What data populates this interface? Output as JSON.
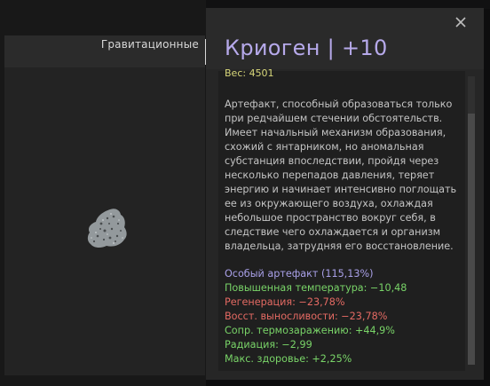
{
  "category_label": "Гравитационные",
  "window": {
    "title": "Криоген | +10"
  },
  "weight_text": "Вес: 4501",
  "description": "Артефакт, способный образоваться только при редчайшем стечении обстоятельств. Имеет начальный механизм образования, схожий с янтарником, но аномальная субстанция впоследствии, пройдя через несколько перепадов давления, теряет энергию и начинает интенсивно поглощать ее из окружающего воздуха, охлаждая небольшое пространство вокруг себя, в следствие чего охлаждается и организм владельца, затрудняя его восстановление.",
  "stats": [
    {
      "text": "Особый артефакт (115,13%)",
      "color": "#a9a0e8"
    },
    {
      "text": "Повышенная температура: −10,48",
      "color": "#79d468"
    },
    {
      "text": "Регенерация: −23,78%",
      "color": "#e46a63"
    },
    {
      "text": "Восст. выносливости: −23,78%",
      "color": "#e46a63"
    },
    {
      "text": "Сопр. термозаражению: +44,9%",
      "color": "#79d468"
    },
    {
      "text": "Радиация: −2,99",
      "color": "#79d468"
    },
    {
      "text": "Макс. здоровье: +2,25%",
      "color": "#79d468"
    }
  ],
  "icons": {
    "close": "close-icon",
    "artifact": "artifact-cryogen-image"
  },
  "colors": {
    "title": "#b6a9ea",
    "weight": "#d8d77a",
    "text": "#c4c4c4"
  }
}
